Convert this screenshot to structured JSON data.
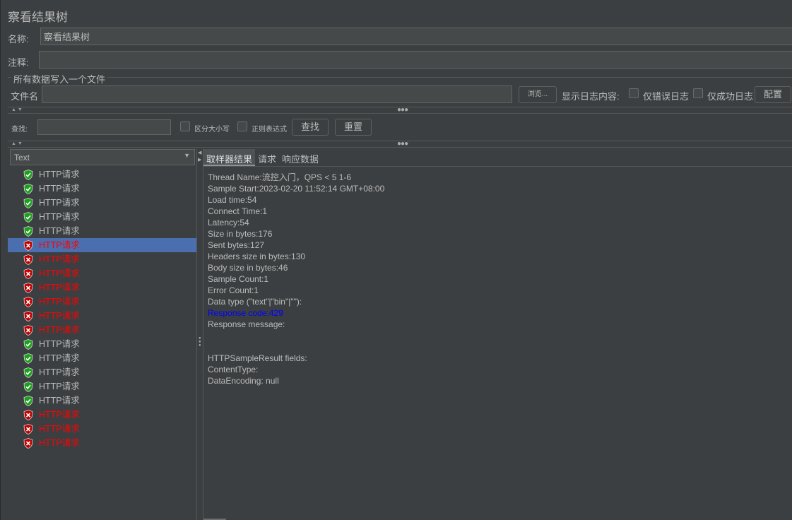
{
  "title": "察看结果树",
  "name_label": "名称:",
  "name_value": "察看结果树",
  "comment_label": "注释:",
  "comment_value": "",
  "file_section": {
    "legend": "所有数据写入一个文件",
    "file_label": "文件名",
    "file_value": "",
    "browse": "浏览...",
    "log_label": "显示日志内容:",
    "errors_only": "仅错误日志",
    "success_only": "仅成功日志",
    "configure": "配置"
  },
  "search": {
    "label": "查找:",
    "value": "",
    "case_sensitive": "区分大小写",
    "regex": "正则表达式",
    "find": "查找",
    "reset": "重置"
  },
  "renderer": {
    "selected": "Text"
  },
  "tree": [
    {
      "label": "HTTP请求",
      "status": "success"
    },
    {
      "label": "HTTP请求",
      "status": "success"
    },
    {
      "label": "HTTP请求",
      "status": "success"
    },
    {
      "label": "HTTP请求",
      "status": "success"
    },
    {
      "label": "HTTP请求",
      "status": "success"
    },
    {
      "label": "HTTP请求",
      "status": "fail",
      "selected": true
    },
    {
      "label": "HTTP请求",
      "status": "fail"
    },
    {
      "label": "HTTP请求",
      "status": "fail"
    },
    {
      "label": "HTTP请求",
      "status": "fail"
    },
    {
      "label": "HTTP请求",
      "status": "fail"
    },
    {
      "label": "HTTP请求",
      "status": "fail"
    },
    {
      "label": "HTTP请求",
      "status": "fail"
    },
    {
      "label": "HTTP请求",
      "status": "success"
    },
    {
      "label": "HTTP请求",
      "status": "success"
    },
    {
      "label": "HTTP请求",
      "status": "success"
    },
    {
      "label": "HTTP请求",
      "status": "success"
    },
    {
      "label": "HTTP请求",
      "status": "success"
    },
    {
      "label": "HTTP请求",
      "status": "fail"
    },
    {
      "label": "HTTP请求",
      "status": "fail"
    },
    {
      "label": "HTTP请求",
      "status": "fail"
    }
  ],
  "tabs": [
    "取样器结果",
    "请求",
    "响应数据"
  ],
  "details": [
    {
      "text": "Thread Name:流控入门，QPS < 5 1-6"
    },
    {
      "text": "Sample Start:2023-02-20 11:52:14 GMT+08:00"
    },
    {
      "text": "Load time:54"
    },
    {
      "text": "Connect Time:1"
    },
    {
      "text": "Latency:54"
    },
    {
      "text": "Size in bytes:176"
    },
    {
      "text": "Sent bytes:127"
    },
    {
      "text": "Headers size in bytes:130"
    },
    {
      "text": "Body size in bytes:46"
    },
    {
      "text": "Sample Count:1"
    },
    {
      "text": "Error Count:1"
    },
    {
      "text": "Data type (\"text\"|\"bin\"|\"\"):"
    },
    {
      "text": "Response code:429",
      "color": "#0000ff"
    },
    {
      "text": "Response message:"
    },
    {
      "text": ""
    },
    {
      "text": ""
    },
    {
      "text": "HTTPSampleResult fields:"
    },
    {
      "text": "ContentType:"
    },
    {
      "text": "DataEncoding: null"
    }
  ],
  "colors": {
    "background": "#3c3f41",
    "selection": "#4b6eaf",
    "success": "#1ea01e",
    "fail": "#c00000"
  }
}
